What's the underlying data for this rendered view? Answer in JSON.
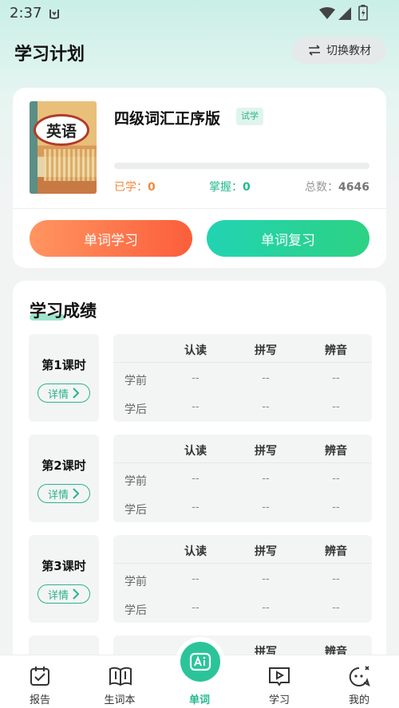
{
  "status": {
    "time": "2:37"
  },
  "header": {
    "title": "学习计划",
    "switch_label": "切换教材"
  },
  "book": {
    "cover_label": "英语",
    "title": "四级词汇正序版",
    "badge": "试学",
    "progress_fraction": 0,
    "learned_label": "已学：",
    "learned_value": "0",
    "mastered_label": "掌握：",
    "mastered_value": "0",
    "total_label": "总数：",
    "total_value": "4646",
    "learn_button": "单词学习",
    "review_button": "单词复习"
  },
  "results": {
    "title": "学习成绩",
    "columns": [
      "认读",
      "拼写",
      "辨音"
    ],
    "row_labels": [
      "学前",
      "学后"
    ],
    "detail_label": "详情",
    "lessons": [
      {
        "name": "第1课时",
        "before": [
          "--",
          "--",
          "--"
        ],
        "after": [
          "--",
          "--",
          "--"
        ]
      },
      {
        "name": "第2课时",
        "before": [
          "--",
          "--",
          "--"
        ],
        "after": [
          "--",
          "--",
          "--"
        ]
      },
      {
        "name": "第3课时",
        "before": [
          "--",
          "--",
          "--"
        ],
        "after": [
          "--",
          "--",
          "--"
        ]
      },
      {
        "name": "",
        "before": [
          "",
          "",
          ""
        ],
        "after": [
          "",
          "",
          ""
        ]
      }
    ]
  },
  "nav": {
    "items": [
      {
        "label": "报告",
        "icon": "report-icon"
      },
      {
        "label": "生词本",
        "icon": "vocab-book-icon"
      },
      {
        "label": "单词",
        "icon": "ai-word-icon"
      },
      {
        "label": "学习",
        "icon": "study-video-icon"
      },
      {
        "label": "我的",
        "icon": "profile-chat-icon"
      }
    ],
    "active_index": 2
  },
  "colors": {
    "accent": "#2bc49a",
    "orange": "#f08a3c",
    "learn_gradient_start": "#ff9560",
    "learn_gradient_end": "#fb5e3b",
    "review_gradient_start": "#22d3b3",
    "review_gradient_end": "#2dd283"
  }
}
